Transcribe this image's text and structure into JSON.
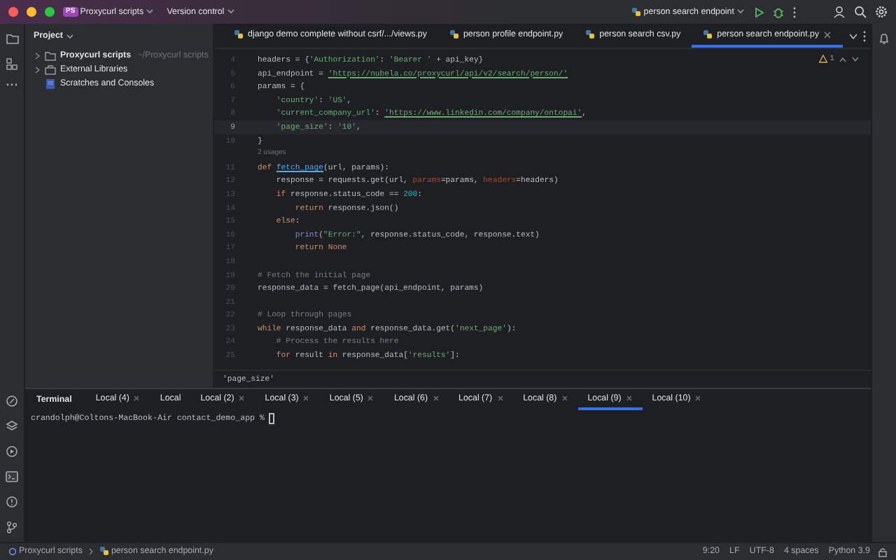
{
  "title_bar": {
    "project_badge": "PS",
    "project": "Proxycurl scripts",
    "vcs": "Version control",
    "run_config": "person search endpoint"
  },
  "project_panel": {
    "title": "Project",
    "items": [
      {
        "kind": "folder",
        "label": "Proxycurl scripts",
        "path": "~/Proxycurl scripts",
        "expandable": true
      },
      {
        "kind": "library",
        "label": "External Libraries",
        "expandable": true
      },
      {
        "kind": "scratch",
        "label": "Scratches and Consoles",
        "expandable": false
      }
    ]
  },
  "editor_tabs": [
    {
      "label": "django demo complete without csrf/.../views.py",
      "selected": false
    },
    {
      "label": "person profile endpoint.py",
      "selected": false
    },
    {
      "label": "person search csv.py",
      "selected": false
    },
    {
      "label": "person search endpoint.py",
      "selected": true
    }
  ],
  "inspection": {
    "warnings": "1"
  },
  "code_lines": [
    {
      "number": "4",
      "current": false,
      "segments": [
        {
          "kind": "plain",
          "text": "headers = {"
        },
        {
          "kind": "str",
          "text": "'Authorization'"
        },
        {
          "kind": "plain",
          "text": ": "
        },
        {
          "kind": "str",
          "text": "'Bearer '"
        },
        {
          "kind": "plain",
          "text": " + api_key}"
        }
      ]
    },
    {
      "number": "5",
      "current": false,
      "segments": [
        {
          "kind": "plain",
          "text": "api_endpoint = "
        },
        {
          "kind": "link",
          "text": "'https://nubela.co/proxycurl/api/v2/search/person/'"
        }
      ]
    },
    {
      "number": "6",
      "current": false,
      "segments": [
        {
          "kind": "plain",
          "text": "params = {"
        }
      ]
    },
    {
      "number": "7",
      "current": false,
      "segments": [
        {
          "kind": "str",
          "text": "    'country'"
        },
        {
          "kind": "plain",
          "text": ": "
        },
        {
          "kind": "str",
          "text": "'US'"
        },
        {
          "kind": "plain",
          "text": ","
        }
      ]
    },
    {
      "number": "8",
      "current": false,
      "segments": [
        {
          "kind": "str",
          "text": "    'current_company_url'"
        },
        {
          "kind": "plain",
          "text": ": "
        },
        {
          "kind": "link",
          "text": "'https://www.linkedin.com/company/ontopai'"
        },
        {
          "kind": "plain",
          "text": ","
        }
      ]
    },
    {
      "number": "9",
      "current": true,
      "segments": [
        {
          "kind": "str",
          "text": "    'page_size'"
        },
        {
          "kind": "plain",
          "text": ": "
        },
        {
          "kind": "str",
          "text": "'10'"
        },
        {
          "kind": "plain",
          "text": ","
        }
      ]
    },
    {
      "number": "10",
      "current": false,
      "segments": [
        {
          "kind": "plain",
          "text": "}"
        }
      ]
    },
    {
      "hint": "2 usages"
    },
    {
      "number": "11",
      "current": false,
      "segments": [
        {
          "kind": "kw",
          "text": "def "
        },
        {
          "kind": "fn",
          "text": "fetch_page"
        },
        {
          "kind": "plain",
          "text": "(url, params):"
        }
      ]
    },
    {
      "number": "12",
      "current": false,
      "segments": [
        {
          "kind": "plain",
          "text": "    response = requests.get(url, "
        },
        {
          "kind": "param",
          "text": "params"
        },
        {
          "kind": "plain",
          "text": "=params, "
        },
        {
          "kind": "param",
          "text": "headers"
        },
        {
          "kind": "plain",
          "text": "=headers)"
        }
      ]
    },
    {
      "number": "13",
      "current": false,
      "segments": [
        {
          "kind": "kw",
          "text": "    if"
        },
        {
          "kind": "plain",
          "text": " response.status_code == "
        },
        {
          "kind": "num",
          "text": "200"
        },
        {
          "kind": "plain",
          "text": ":"
        }
      ]
    },
    {
      "number": "14",
      "current": false,
      "segments": [
        {
          "kind": "kw",
          "text": "        return"
        },
        {
          "kind": "plain",
          "text": " response.json()"
        }
      ]
    },
    {
      "number": "15",
      "current": false,
      "segments": [
        {
          "kind": "kw",
          "text": "    else"
        },
        {
          "kind": "plain",
          "text": ":"
        }
      ]
    },
    {
      "number": "16",
      "current": false,
      "segments": [
        {
          "kind": "builtin",
          "text": "        print"
        },
        {
          "kind": "plain",
          "text": "("
        },
        {
          "kind": "str",
          "text": "\"Error:\""
        },
        {
          "kind": "plain",
          "text": ", response.status_code, response.text)"
        }
      ]
    },
    {
      "number": "17",
      "current": false,
      "segments": [
        {
          "kind": "kw",
          "text": "        return None"
        }
      ]
    },
    {
      "number": "18",
      "current": false
    },
    {
      "number": "19",
      "current": false,
      "segments": [
        {
          "kind": "comment",
          "text": "# Fetch the initial page"
        }
      ]
    },
    {
      "number": "20",
      "current": false,
      "segments": [
        {
          "kind": "plain",
          "text": "response_data = fetch_page(api_endpoint, params)"
        }
      ]
    },
    {
      "number": "21",
      "current": false
    },
    {
      "number": "22",
      "current": false,
      "segments": [
        {
          "kind": "comment",
          "text": "# Loop through pages"
        }
      ]
    },
    {
      "number": "23",
      "current": false,
      "segments": [
        {
          "kind": "kw",
          "text": "while"
        },
        {
          "kind": "plain",
          "text": " response_data "
        },
        {
          "kind": "kw",
          "text": "and"
        },
        {
          "kind": "plain",
          "text": " response_data.get("
        },
        {
          "kind": "str",
          "text": "'next_page'"
        },
        {
          "kind": "plain",
          "text": "):"
        }
      ]
    },
    {
      "number": "24",
      "current": false,
      "segments": [
        {
          "kind": "comment",
          "text": "    # Process the results here"
        }
      ]
    },
    {
      "number": "25",
      "current": false,
      "segments": [
        {
          "kind": "kw",
          "text": "    for"
        },
        {
          "kind": "plain",
          "text": " result "
        },
        {
          "kind": "kw",
          "text": "in"
        },
        {
          "kind": "plain",
          "text": " response_data["
        },
        {
          "kind": "str",
          "text": "'results'"
        },
        {
          "kind": "plain",
          "text": "]:"
        }
      ]
    }
  ],
  "breadcrumb": "'page_size'",
  "terminal": {
    "title": "Terminal",
    "tabs": [
      {
        "label": "Local (4)",
        "closable": true,
        "selected": false
      },
      {
        "label": "Local",
        "closable": false,
        "selected": false
      },
      {
        "label": "Local (2)",
        "closable": true,
        "selected": false
      },
      {
        "label": "Local (3)",
        "closable": true,
        "selected": false
      },
      {
        "label": "Local (5)",
        "closable": true,
        "selected": false
      },
      {
        "label": "Local (6)",
        "closable": true,
        "selected": false
      },
      {
        "label": "Local (7)",
        "closable": true,
        "selected": false
      },
      {
        "label": "Local (8)",
        "closable": true,
        "selected": false
      },
      {
        "label": "Local (9)",
        "closable": true,
        "selected": true
      },
      {
        "label": "Local (10)",
        "closable": true,
        "selected": false
      }
    ],
    "prompt": "crandolph@Coltons-MacBook-Air contact_demo_app % "
  },
  "status_bar": {
    "breadcrumbs": [
      "Proxycurl scripts",
      "person search endpoint.py"
    ],
    "right": [
      "9:20",
      "LF",
      "UTF-8",
      "4 spaces",
      "Python 3.9"
    ]
  }
}
